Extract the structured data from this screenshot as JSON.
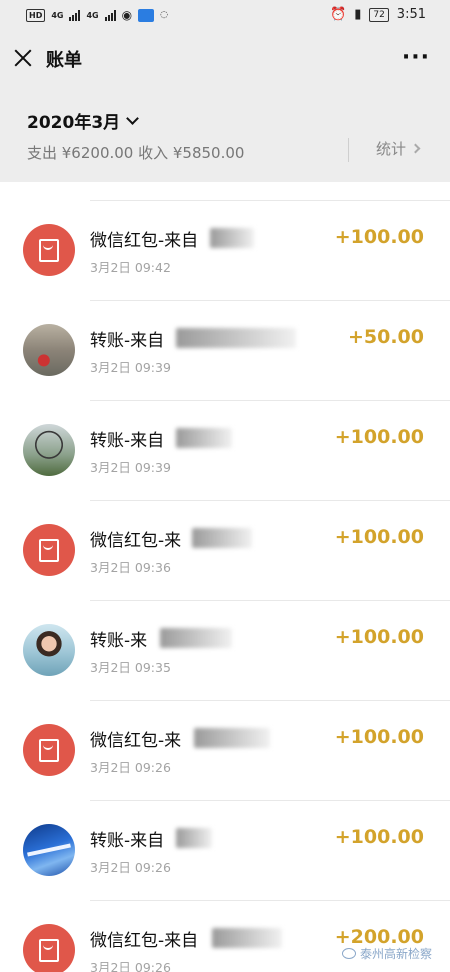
{
  "status_bar": {
    "left_badge": "HD",
    "network_1": "4G",
    "network_2": "4G",
    "battery": "72",
    "time": "3:51"
  },
  "nav": {
    "title": "账单",
    "more_label": "···"
  },
  "summary": {
    "month": "2020年3月",
    "totals": "支出 ¥6200.00 收入 ¥5850.00",
    "stats_label": "统计"
  },
  "transactions": [
    {
      "title": "微信红包-来自",
      "time": "3月2日 09:42",
      "amount": "+100.00",
      "avatar": "red-packet-icon"
    },
    {
      "title": "转账-来自",
      "time": "3月2日 09:39",
      "amount": "+50.00",
      "avatar": "photo"
    },
    {
      "title": "转账-来自",
      "time": "3月2日 09:39",
      "amount": "+100.00",
      "avatar": "photo"
    },
    {
      "title": "微信红包-来",
      "time": "3月2日 09:36",
      "amount": "+100.00",
      "avatar": "red-packet-icon"
    },
    {
      "title": "转账-来",
      "time": "3月2日 09:35",
      "amount": "+100.00",
      "avatar": "photo"
    },
    {
      "title": "微信红包-来",
      "time": "3月2日 09:26",
      "amount": "+100.00",
      "avatar": "red-packet-icon"
    },
    {
      "title": "转账-来自",
      "time": "3月2日 09:26",
      "amount": "+100.00",
      "avatar": "photo"
    },
    {
      "title": "微信红包-来自",
      "time": "3月2日 09:26",
      "amount": "+200.00",
      "avatar": "red-packet-icon"
    }
  ],
  "watermark": "泰州高新检察",
  "colors": {
    "amount": "#d3a32b",
    "header_bg": "#ededed",
    "red_packet": "#e0574a"
  }
}
